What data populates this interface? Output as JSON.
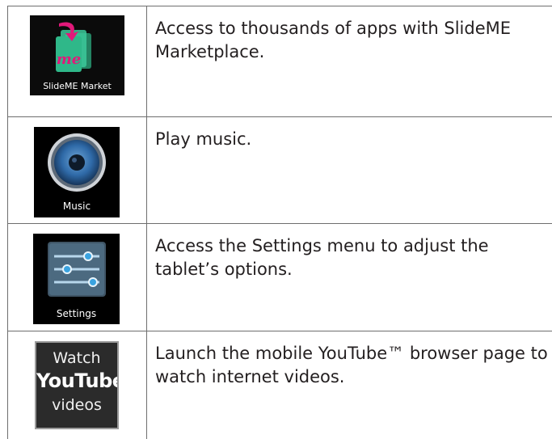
{
  "rows": [
    {
      "icon": {
        "name": "slideme-market-icon",
        "label": "SlideME Market",
        "glyph": "me"
      },
      "description": "Access to thousands of apps with SlideME Marketplace."
    },
    {
      "icon": {
        "name": "music-icon",
        "label": "Music"
      },
      "description": "Play music."
    },
    {
      "icon": {
        "name": "settings-icon",
        "label": "Settings"
      },
      "description": "Access the Settings menu to adjust the tablet’s options."
    },
    {
      "icon": {
        "name": "youtube-icon",
        "label_top": "Watch",
        "label_brand": "YouTube",
        "label_bottom": "videos"
      },
      "description": "Launch the mobile YouTube™ browser page to watch internet videos."
    }
  ],
  "colors": {
    "border": "#6e6e6e",
    "text": "#231f20",
    "slideme_green": "#2fb889",
    "slideme_pink": "#e1197a",
    "settings_blue": "#3aa3e0"
  }
}
